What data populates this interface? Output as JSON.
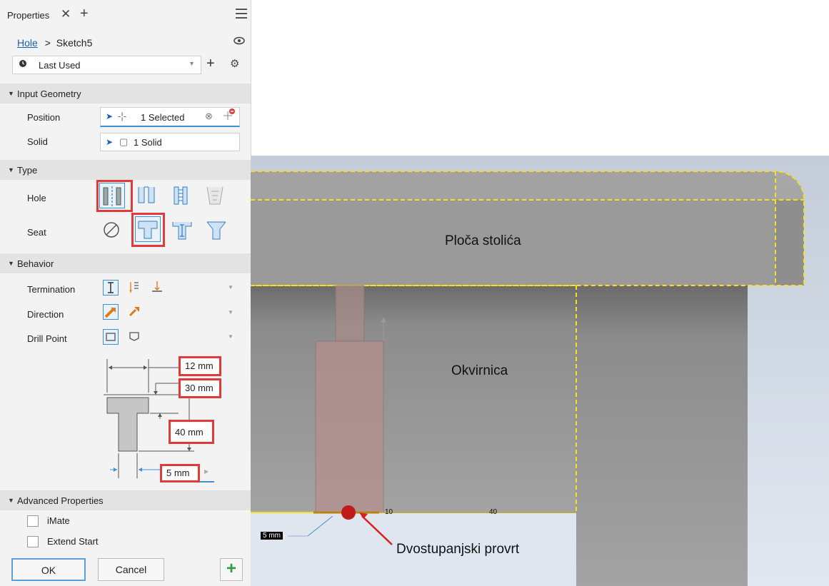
{
  "panel": {
    "tab_title": "Properties",
    "tab_close": "✕",
    "tab_add": "+",
    "breadcrumb": {
      "feature": "Hole",
      "separator": ">",
      "sketch": "Sketch5"
    },
    "preset": {
      "value": "Last Used",
      "add": "+"
    },
    "sections": {
      "input_geometry": "Input Geometry",
      "type": "Type",
      "behavior": "Behavior",
      "advanced": "Advanced Properties"
    },
    "input_geometry": {
      "position_label": "Position",
      "position_value": "1 Selected",
      "solid_label": "Solid",
      "solid_value": "1 Solid"
    },
    "type": {
      "hole_label": "Hole",
      "seat_label": "Seat"
    },
    "behavior": {
      "termination_label": "Termination",
      "direction_label": "Direction",
      "drill_point_label": "Drill Point"
    },
    "dimensions": {
      "cbore_diameter": "12 mm",
      "cbore_depth": "30 mm",
      "hole_depth": "40 mm",
      "hole_diameter": "5 mm"
    },
    "advanced": {
      "imate_label": "iMate",
      "extend_start_label": "Extend Start"
    },
    "buttons": {
      "ok": "OK",
      "cancel": "Cancel",
      "apply": "+"
    }
  },
  "viewport": {
    "top_label": "Ploča stolića",
    "frame_label": "Okvirnica",
    "hole_label": "Dvostupanjski provrt",
    "dim_5": "5 mm",
    "dim_10": "10",
    "dim_40": "40"
  },
  "colors": {
    "accent": "#1a5fb4",
    "highlight": "#e03a3a",
    "selection": "#f5e11c"
  }
}
